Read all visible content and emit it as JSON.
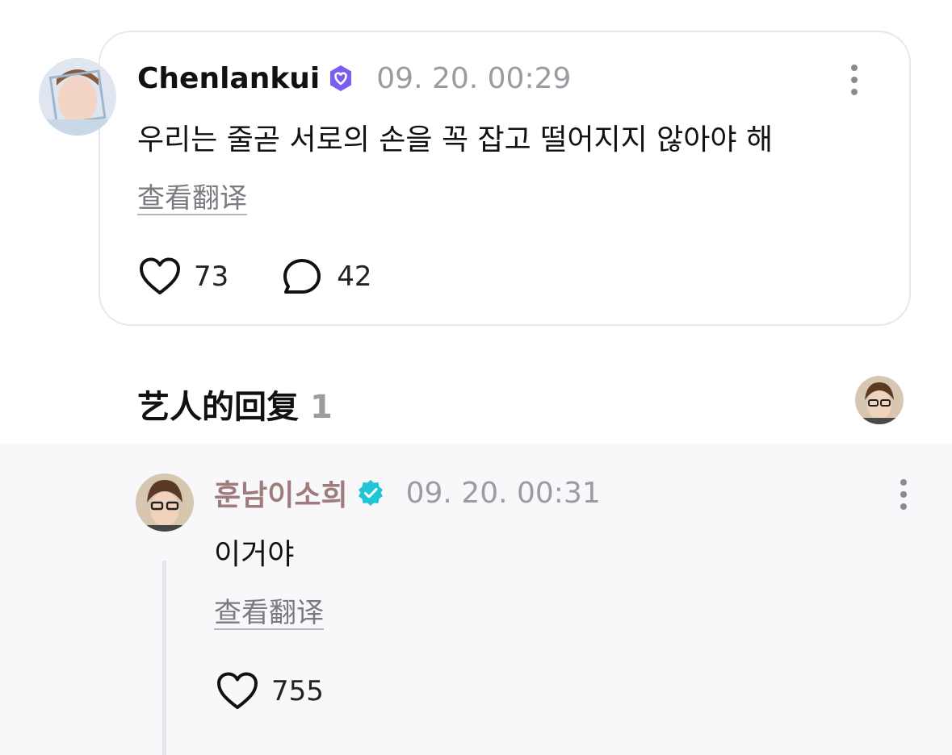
{
  "comment": {
    "author": "Chenlankui",
    "time": "09. 20. 00:29",
    "text": "우리는 줄곧 서로의 손을 꼭 잡고 떨어지지 않아야 해",
    "translate_label": "查看翻译",
    "likes": "73",
    "replies": "42",
    "badge_color": "#7b5cf0",
    "icons": [
      "verified-badge-icon",
      "more-vertical-icon",
      "heart-icon",
      "comment-bubble-icon"
    ]
  },
  "artist_replies": {
    "title": "艺人的回复",
    "count": "1"
  },
  "reply": {
    "author": "훈남이소희",
    "author_color": "#a07b7b",
    "time": "09. 20. 00:31",
    "text": "이거야",
    "translate_label": "查看翻译",
    "likes": "755",
    "badge_color": "#22c5d6",
    "icons": [
      "verified-badge-icon",
      "more-vertical-icon",
      "heart-icon"
    ]
  }
}
